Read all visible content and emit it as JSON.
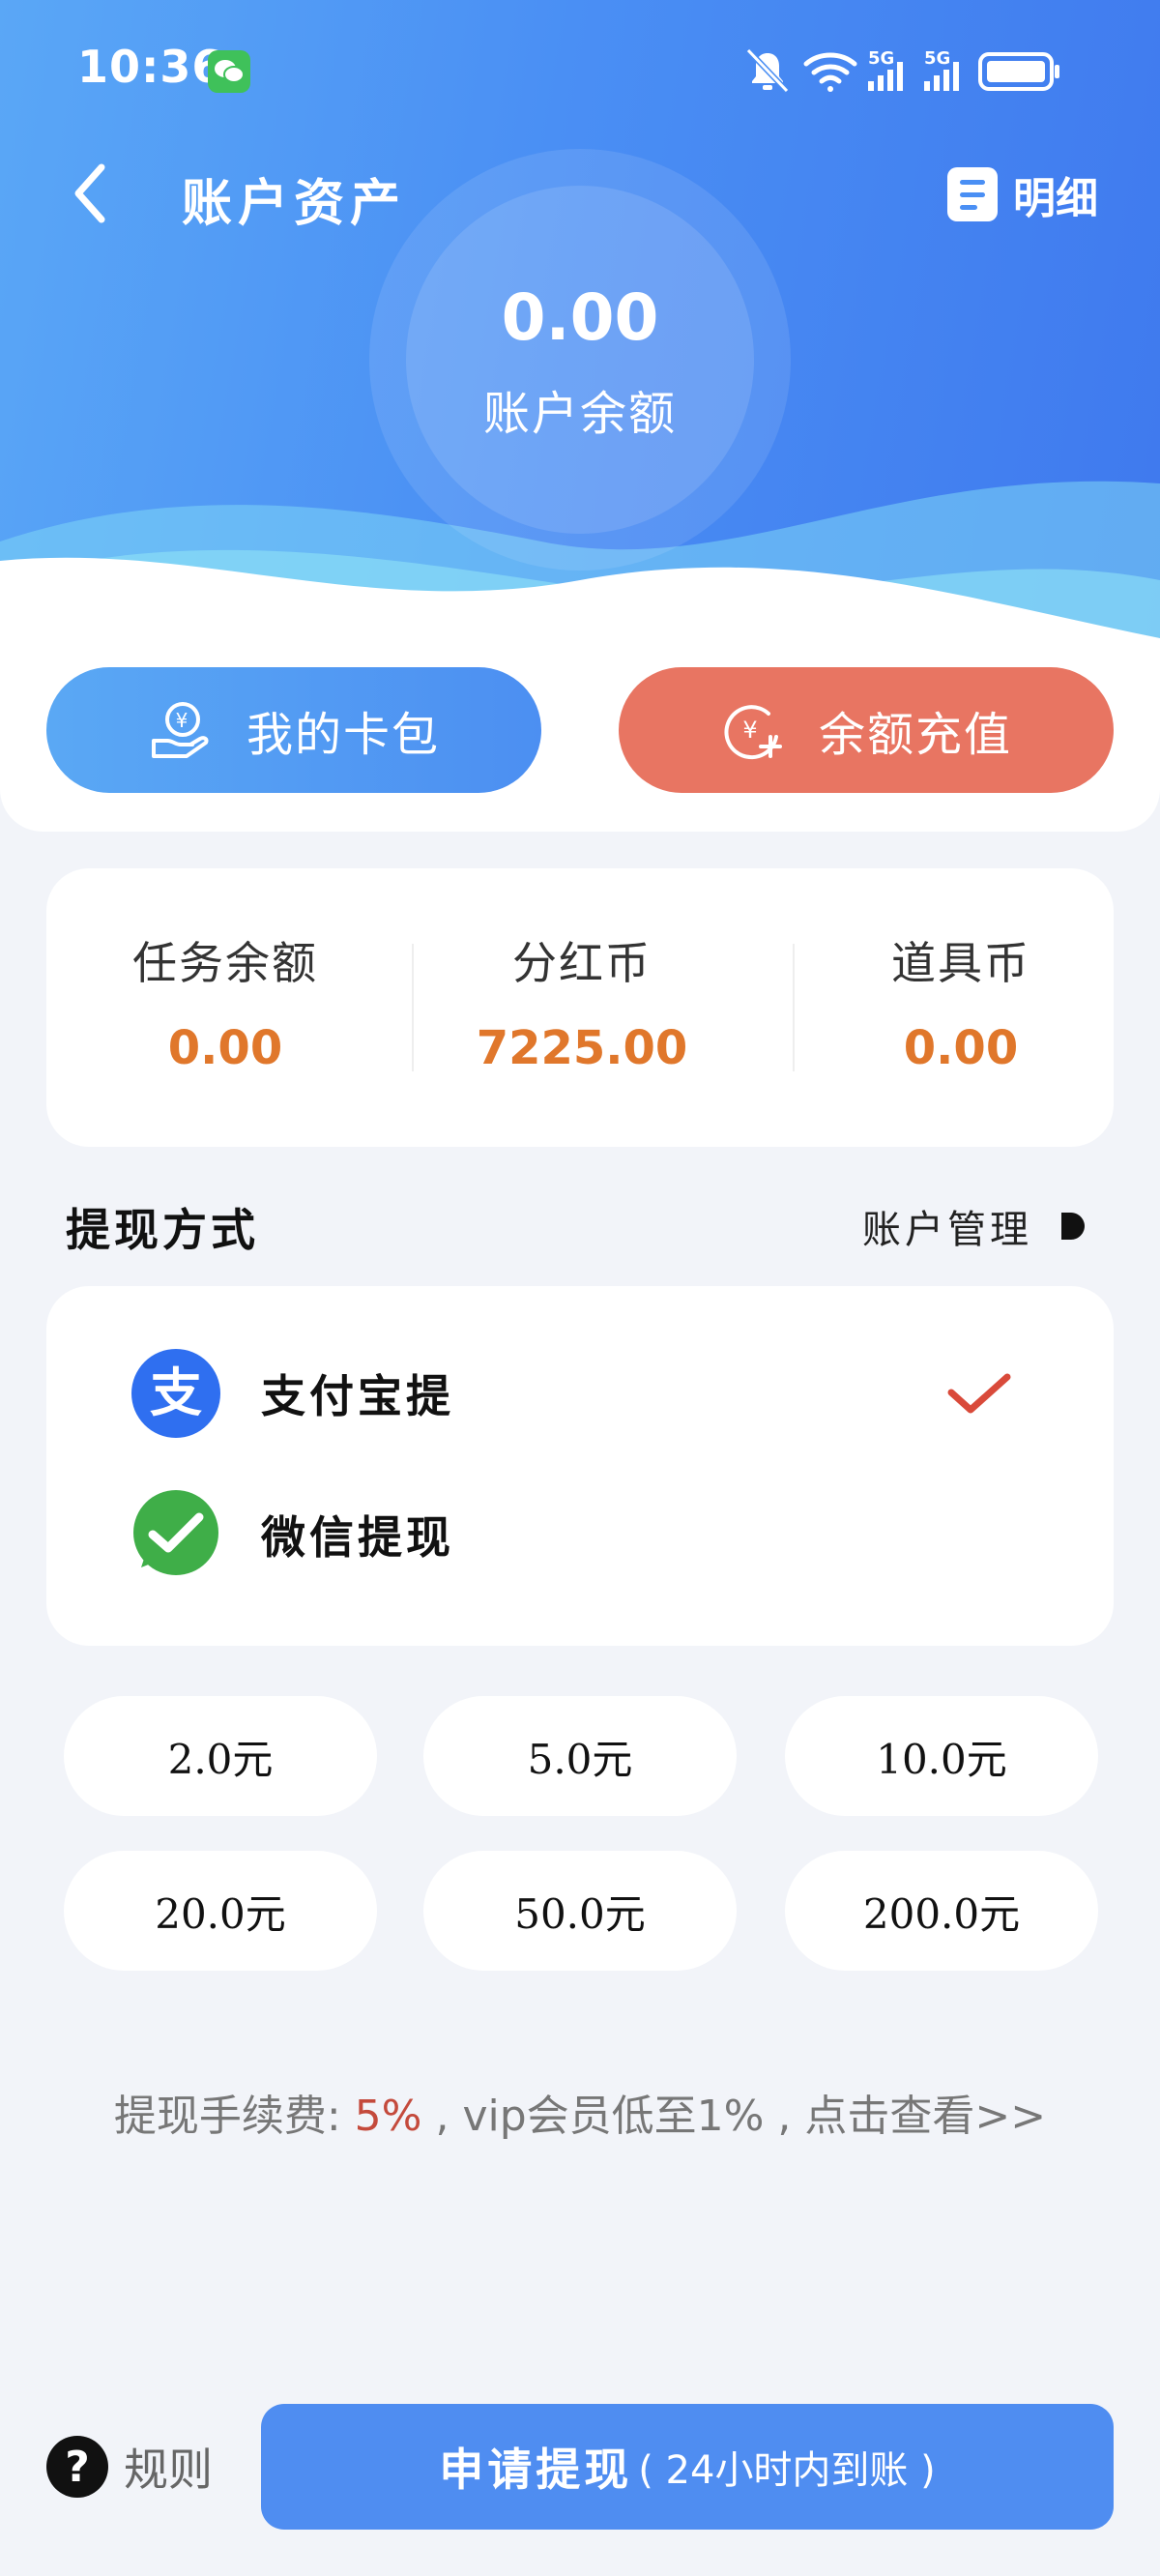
{
  "status_bar": {
    "time": "10:36",
    "icons": [
      "wechat-icon",
      "mute-bell-icon",
      "wifi-icon",
      "signal-5g-icon",
      "signal-5g-icon",
      "battery-icon"
    ],
    "network_label_1": "5G",
    "network_label_2": "5G"
  },
  "header": {
    "title": "账户资产",
    "detail_label": "明细",
    "balance_amount": "0.00",
    "balance_label": "账户余额"
  },
  "actions": {
    "card_pack_label": "我的卡包",
    "recharge_label": "余额充值"
  },
  "stats": [
    {
      "label": "任务余额",
      "value": "0.00"
    },
    {
      "label": "分红币",
      "value": "7225.00"
    },
    {
      "label": "道具币",
      "value": "0.00"
    }
  ],
  "withdraw": {
    "section_title": "提现方式",
    "account_manage_label": "账户管理",
    "methods": [
      {
        "label": "支付宝提",
        "icon": "alipay-icon",
        "selected": true
      },
      {
        "label": "微信提现",
        "icon": "wechat-pay-icon",
        "selected": false
      }
    ]
  },
  "amounts": [
    "2.0元",
    "5.0元",
    "10.0元",
    "20.0元",
    "50.0元",
    "200.0元"
  ],
  "fee_note": {
    "prefix": "提现手续费: ",
    "rate": "5%",
    "suffix": " , vip会员低至1% , 点击查看>>"
  },
  "footer": {
    "rules_label": "规则",
    "submit_main": "申请提现",
    "submit_sub": "( 24小时内到账 )"
  },
  "colors": {
    "primary": "#4f8df1",
    "recharge": "#e87562",
    "stat_value": "#e0772b",
    "check": "#d94a3a"
  }
}
